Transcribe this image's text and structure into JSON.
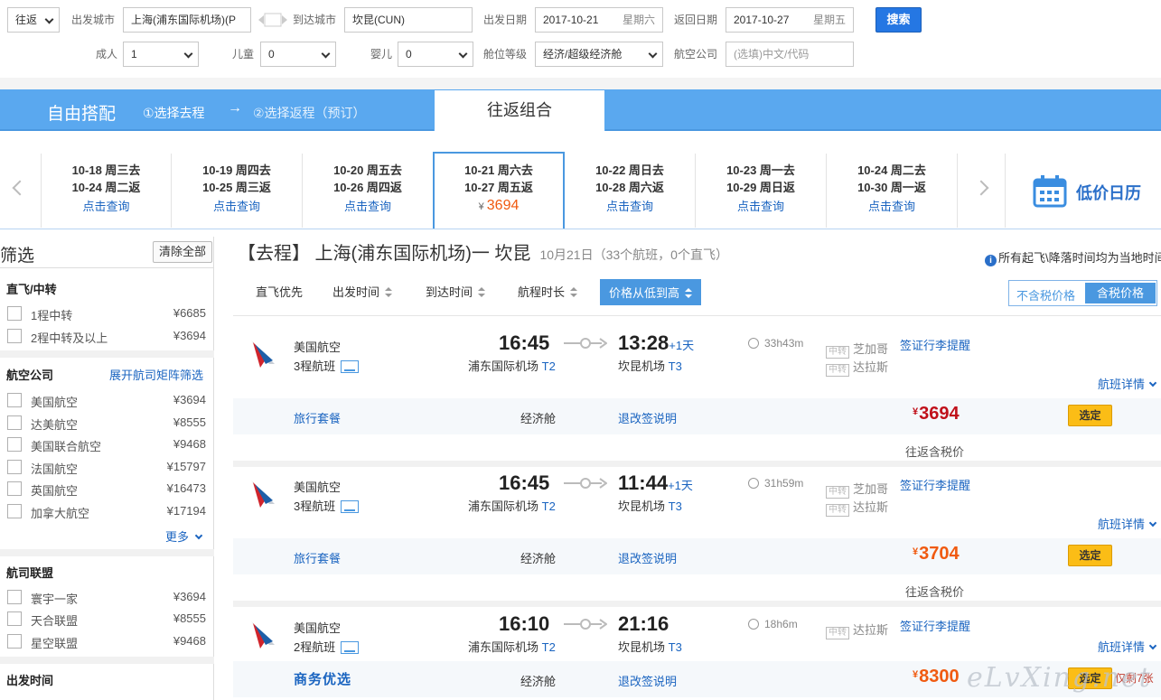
{
  "search": {
    "trip_type": "往返",
    "from_label": "出发城市",
    "from_value": "上海(浦东国际机场)(P",
    "to_label": "到达城市",
    "to_value": "坎昆(CUN)",
    "depart_label": "出发日期",
    "depart_date": "2017-10-21",
    "depart_weekday": "星期六",
    "return_label": "返回日期",
    "return_date": "2017-10-27",
    "return_weekday": "星期五",
    "search_button": "搜索",
    "adult_label": "成人",
    "adult_value": "1",
    "child_label": "儿童",
    "child_value": "0",
    "infant_label": "婴儿",
    "infant_value": "0",
    "cabin_label": "舱位等级",
    "cabin_value": "经济/超级经济舱",
    "airline_label": "航空公司",
    "airline_placeholder": "(选填)中文/代码"
  },
  "band": {
    "title": "自由搭配",
    "step1": "①选择去程",
    "arrow": "→",
    "step2": "②选择返程（预订）",
    "tab": "往返组合"
  },
  "dates": [
    {
      "go": "10-18 周三去",
      "back": "10-24 周二返",
      "action": "点击查询"
    },
    {
      "go": "10-19 周四去",
      "back": "10-25 周三返",
      "action": "点击查询"
    },
    {
      "go": "10-20 周五去",
      "back": "10-26 周四返",
      "action": "点击查询"
    },
    {
      "go": "10-21 周六去",
      "back": "10-27 周五返",
      "currency": "¥",
      "price": "3694"
    },
    {
      "go": "10-22 周日去",
      "back": "10-28 周六返",
      "action": "点击查询"
    },
    {
      "go": "10-23 周一去",
      "back": "10-29 周日返",
      "action": "点击查询"
    },
    {
      "go": "10-24 周二去",
      "back": "10-30 周一返",
      "action": "点击查询"
    }
  ],
  "calendar_label": "低价日历",
  "sidebar": {
    "title": "筛选",
    "clear": "清除全部",
    "transfer_title": "直飞/中转",
    "transfer": [
      {
        "name": "1程中转",
        "price": "¥6685"
      },
      {
        "name": "2程中转及以上",
        "price": "¥3694"
      }
    ],
    "airline_title": "航空公司",
    "airline_link": "展开航司矩阵筛选",
    "airlines": [
      {
        "name": "美国航空",
        "price": "¥3694"
      },
      {
        "name": "达美航空",
        "price": "¥8555"
      },
      {
        "name": "美国联合航空",
        "price": "¥9468"
      },
      {
        "name": "法国航空",
        "price": "¥15797"
      },
      {
        "name": "英国航空",
        "price": "¥16473"
      },
      {
        "name": "加拿大航空",
        "price": "¥17194"
      }
    ],
    "more": "更多",
    "alliance_title": "航司联盟",
    "alliances": [
      {
        "name": "寰宇一家",
        "price": "¥3694"
      },
      {
        "name": "天合联盟",
        "price": "¥8555"
      },
      {
        "name": "星空联盟",
        "price": "¥9468"
      }
    ],
    "time_title": "出发时间"
  },
  "main": {
    "route": "【去程】 上海(浦东国际机场)一 坎昆",
    "count": "10月21日（33个航班，0个直飞）",
    "notice": "所有起飞\\降落时间均为当地时间"
  },
  "sort": {
    "direct": "直飞优先",
    "depart": "出发时间",
    "arrive": "到达时间",
    "duration": "航程时长",
    "price": "价格从低到高",
    "tax_excl": "不含税价格",
    "tax_incl": "含税价格"
  },
  "flights": [
    {
      "airline": "美国航空",
      "legs": "3程航班",
      "dep_time": "16:45",
      "dep_airport": "浦东国际机场",
      "dep_term": "T2",
      "arr_time": "13:28",
      "arr_plus": "+1天",
      "arr_airport": "坎昆机场",
      "arr_term": "T3",
      "duration": "33h43m",
      "stop1": "芝加哥",
      "stop2": "达拉斯",
      "visa": "签证行李提醒",
      "detail": "航班详情",
      "pkg": "旅行套餐",
      "cabin": "经济舱",
      "refund": "退改签说明",
      "currency": "¥",
      "price": "3694",
      "select": "选定",
      "incl": "往返含税价"
    },
    {
      "airline": "美国航空",
      "legs": "3程航班",
      "dep_time": "16:45",
      "dep_airport": "浦东国际机场",
      "dep_term": "T2",
      "arr_time": "11:44",
      "arr_plus": "+1天",
      "arr_airport": "坎昆机场",
      "arr_term": "T3",
      "duration": "31h59m",
      "stop1": "芝加哥",
      "stop2": "达拉斯",
      "visa": "签证行李提醒",
      "detail": "航班详情",
      "pkg": "旅行套餐",
      "cabin": "经济舱",
      "refund": "退改签说明",
      "currency": "¥",
      "price": "3704",
      "select": "选定",
      "incl": "往返含税价"
    },
    {
      "airline": "美国航空",
      "legs": "2程航班",
      "dep_time": "16:10",
      "dep_airport": "浦东国际机场",
      "dep_term": "T2",
      "arr_time": "21:16",
      "arr_airport": "坎昆机场",
      "arr_term": "T3",
      "duration": "18h6m",
      "stop1": "达拉斯",
      "visa": "签证行李提醒",
      "detail": "航班详情",
      "pkg": "商务优选",
      "cabin": "经济舱",
      "refund": "退改签说明",
      "currency": "¥",
      "price": "8300",
      "select": "选定",
      "remaining": "仅剩7张"
    }
  ],
  "stop_tag": "中转",
  "watermark": "eLvXing.net",
  "colors": {
    "accent": "#4a98e0",
    "price_red": "#c0101a",
    "price_orange": "#f05a10",
    "select_yellow": "#fbbd16",
    "link": "#1a64c0"
  }
}
